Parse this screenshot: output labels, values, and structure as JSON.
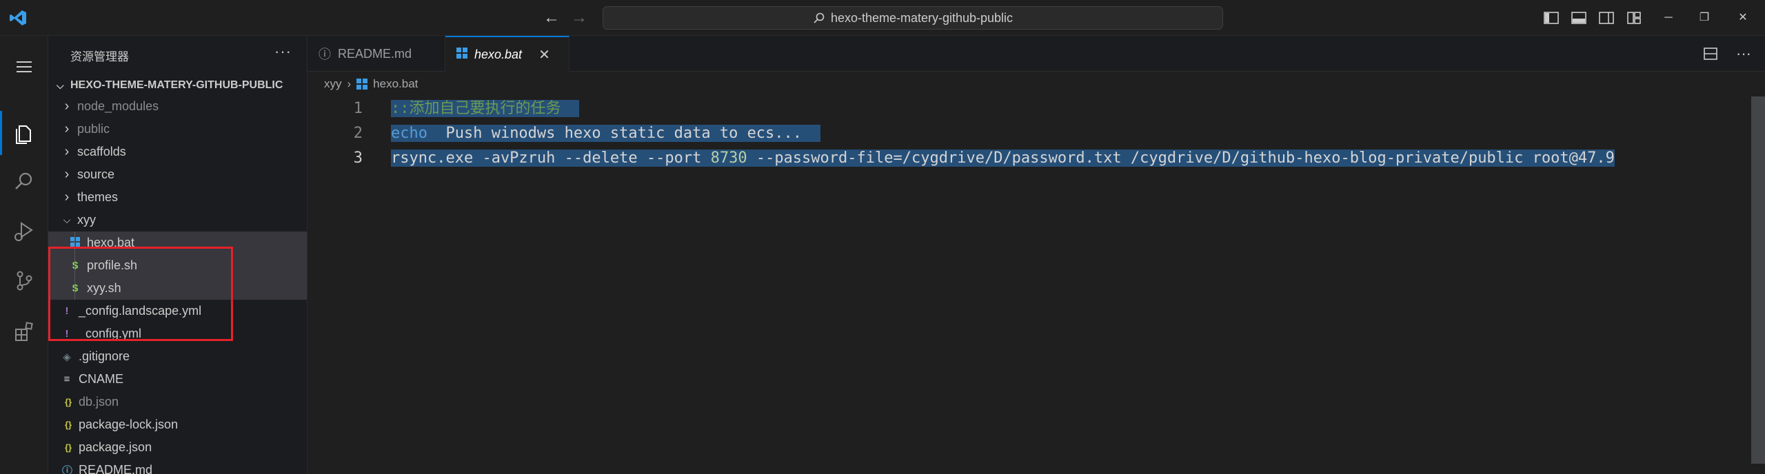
{
  "titlebar": {
    "search_text": "hexo-theme-matery-github-public",
    "back_icon": "arrow-left-icon",
    "forward_icon": "arrow-right-icon",
    "brand_color": "#3b9de8"
  },
  "activity_bar": {
    "items": [
      "menu-icon",
      "explorer-icon",
      "search-icon",
      "run-debug-icon",
      "source-control-icon",
      "extensions-icon"
    ],
    "active": "explorer-icon",
    "accent": "#0078d4"
  },
  "sidebar": {
    "title": "资源管理器",
    "more": "···",
    "workspace": "HEXO-THEME-MATERY-GITHUB-PUBLIC",
    "items": [
      {
        "label": "node_modules",
        "type": "folder"
      },
      {
        "label": "public",
        "type": "folder"
      },
      {
        "label": "scaffolds",
        "type": "folder"
      },
      {
        "label": "source",
        "type": "folder"
      },
      {
        "label": "themes",
        "type": "folder"
      },
      {
        "label": "xyy",
        "type": "folder-open"
      },
      {
        "label": "hexo.bat",
        "type": "bat"
      },
      {
        "label": "profile.sh",
        "type": "sh"
      },
      {
        "label": "xyy.sh",
        "type": "sh"
      },
      {
        "label": "_config.landscape.yml",
        "type": "yml"
      },
      {
        "label": "_config.yml",
        "type": "yml"
      },
      {
        "label": ".gitignore",
        "type": "git"
      },
      {
        "label": "CNAME",
        "type": "text"
      },
      {
        "label": "db.json",
        "type": "json"
      },
      {
        "label": "package-lock.json",
        "type": "json"
      },
      {
        "label": "package.json",
        "type": "json"
      },
      {
        "label": "README.md",
        "type": "info"
      }
    ],
    "glyphs": {
      "yml": "!",
      "json": "{}",
      "sh": "$",
      "git": "◈",
      "text": "≡",
      "info": "ⓘ"
    }
  },
  "tabs": [
    {
      "label": "README.md",
      "icon": "ⓘ"
    },
    {
      "label": "hexo.bat",
      "icon": "windows-icon",
      "close": "✕"
    }
  ],
  "breadcrumb": {
    "folder": "xyy",
    "sep": "›",
    "file": "hexo.bat"
  },
  "editor": {
    "lines": [
      {
        "n": "1",
        "parts": [
          {
            "t": "::添加自己要执行的任务",
            "c": "cmt"
          }
        ]
      },
      {
        "n": "2",
        "parts": [
          {
            "t": "echo",
            "c": "kw"
          },
          {
            "t": "  Push winodws hexo static data to ecs...",
            "c": "txt"
          }
        ]
      },
      {
        "n": "3",
        "parts": [
          {
            "t": "rsync.exe -avPzruh --delete --port ",
            "c": "txt"
          },
          {
            "t": "8730",
            "c": "num"
          },
          {
            "t": " --password-file=/cygdrive/D/password.txt /cygdrive/D/github-hexo-blog-private/public root@47.9",
            "c": "txt"
          }
        ]
      }
    ],
    "selection_color": "#264f78"
  }
}
